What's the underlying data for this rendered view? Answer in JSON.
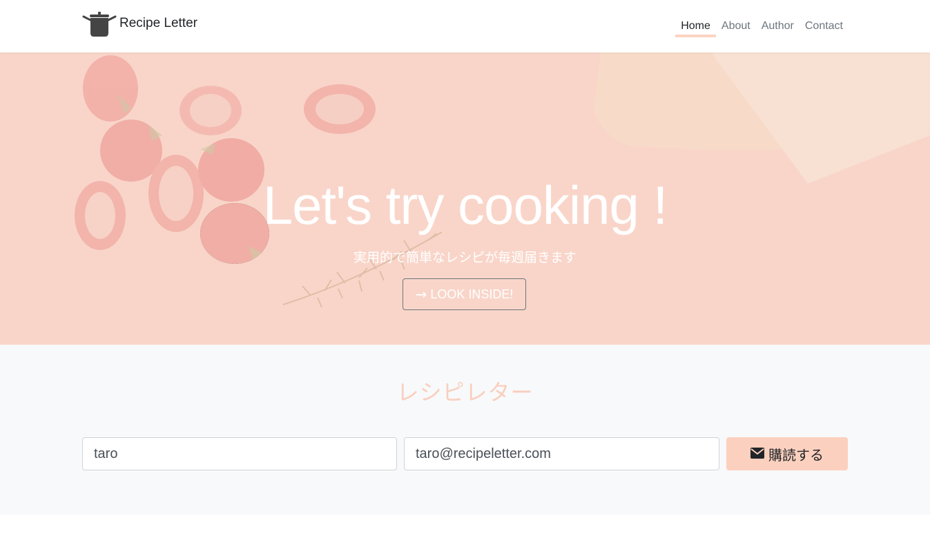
{
  "navbar": {
    "brand": "Recipe Letter",
    "brand_icon": "cooking-pot-icon",
    "items": [
      {
        "label": "Home",
        "active": true
      },
      {
        "label": "About",
        "active": false
      },
      {
        "label": "Author",
        "active": false
      },
      {
        "label": "Contact",
        "active": false
      }
    ]
  },
  "hero": {
    "title": "Let's try cooking !",
    "subtitle": "実用的で簡単なレシピが毎週届きます",
    "button_label": "LOOK INSIDE!",
    "button_icon": "arrow-right-icon"
  },
  "subscribe": {
    "title": "レシピレター",
    "name_value": "taro",
    "email_value": "taro@recipeletter.com",
    "button_label": "購読する",
    "button_icon": "envelope-icon"
  },
  "colors": {
    "accent": "#fbd3c3",
    "hero_overlay": "#f9d3c7",
    "section_bg": "#f8f9fa"
  }
}
